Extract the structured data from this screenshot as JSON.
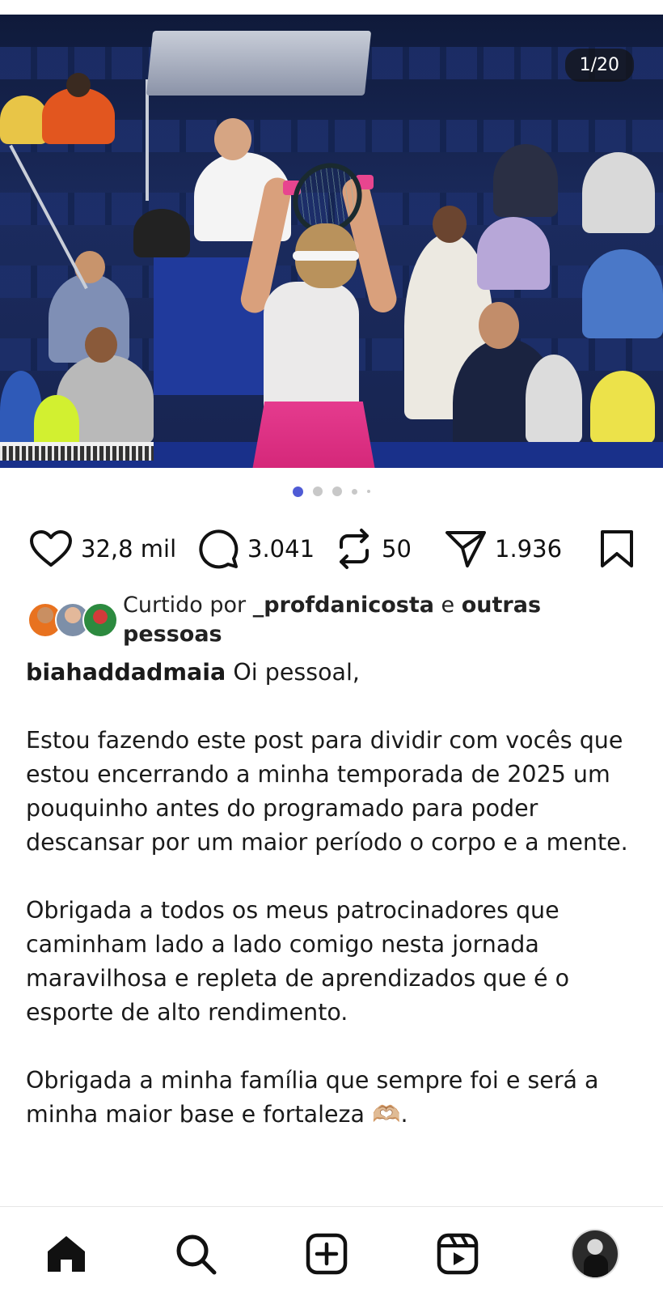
{
  "post": {
    "media": {
      "counter": "1/20",
      "carousel_dots": 5,
      "active_dot": 0
    },
    "actions": {
      "likes": "32,8 mil",
      "comments": "3.041",
      "reposts": "50",
      "shares": "1.936"
    },
    "liked_by": {
      "prefix": "Curtido por ",
      "user": "_profdanicosta",
      "conjunction": " e ",
      "others": "outras pessoas"
    },
    "caption": {
      "username": "biahaddadmaia",
      "first_line": " Oi pessoal,",
      "paragraph_1": "Estou fazendo este post para dividir com vocês que estou encerrando a minha temporada de 2025 um pouquinho antes do programado para poder descansar por um maior período o corpo e a mente.",
      "paragraph_2": "Obrigada a todos os meus patrocinadores que caminham lado a lado comigo nesta jornada maravilhosa e repleta de aprendizados que é o esporte de alto rendimento.",
      "paragraph_3": "Obrigada a minha família que sempre foi e será a minha maior base e fortaleza 🫶🏼."
    }
  },
  "bottom_nav": {
    "items": [
      "home-icon",
      "search-icon",
      "create-icon",
      "reels-icon",
      "profile-avatar"
    ]
  },
  "colors": {
    "active_dot": "#4f5bd5",
    "inactive_dot": "#c8c8c8",
    "skirt": "#e53b8e"
  }
}
